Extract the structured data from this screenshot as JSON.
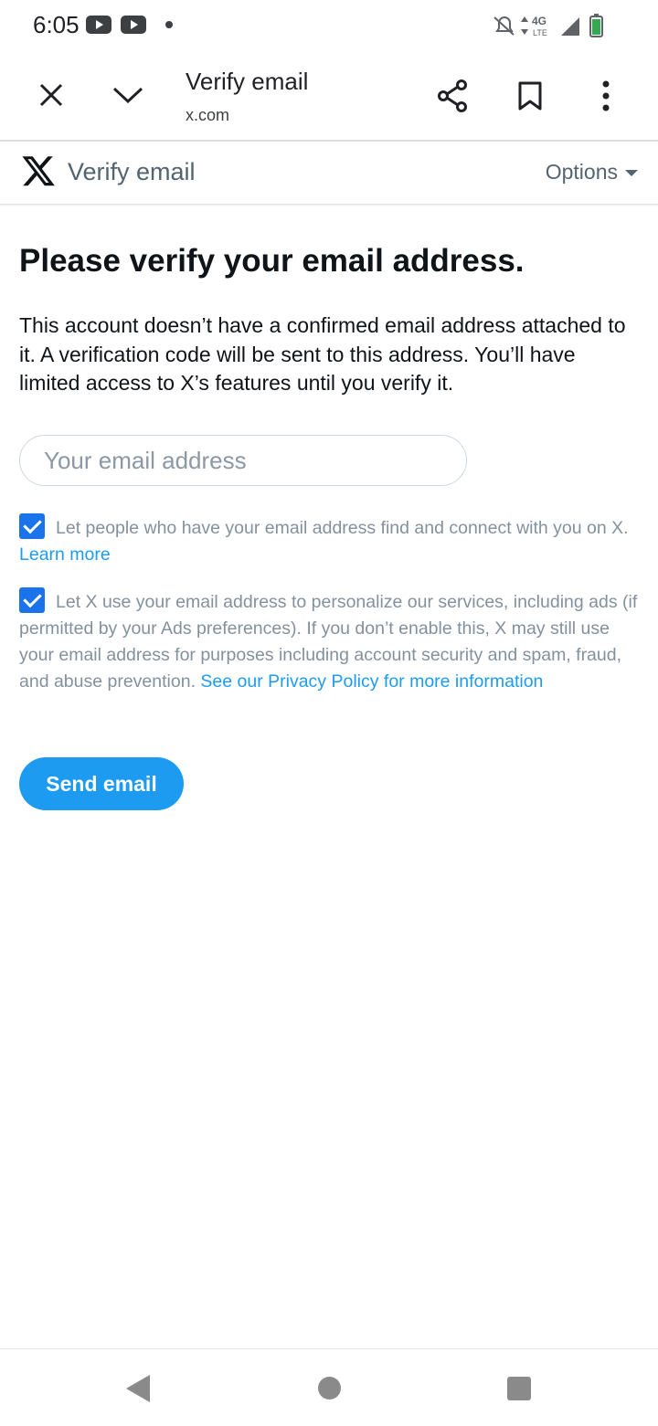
{
  "status_bar": {
    "time": "6:05",
    "network": "4G",
    "network_sub": "LTE"
  },
  "toolbar": {
    "title": "Verify email",
    "url": "x.com"
  },
  "x_header": {
    "title": "Verify email",
    "options_label": "Options"
  },
  "main": {
    "heading": "Please verify your email address.",
    "description": "This account doesn’t have a confirmed email address attached to it. A verification code will be sent to this address. You’ll have limited access to X’s features until you verify it.",
    "email_placeholder": "Your email address",
    "email_value": "",
    "checkbox1": {
      "checked": true,
      "text": "Let people who have your email address find and connect with you on X.",
      "link": "Learn more"
    },
    "checkbox2": {
      "checked": true,
      "text": "Let X use your email address to personalize our services, including ads (if permitted by your Ads preferences). If you don’t enable this, X may still use your email address for purposes including account security and spam, fraud, and abuse prevention.",
      "link": "See our Privacy Policy for more information"
    },
    "send_button": "Send email"
  },
  "colors": {
    "accent": "#1d9bf0",
    "checkbox": "#1a73e8",
    "text_primary": "#0f1419",
    "text_secondary": "#536471"
  },
  "icons": [
    "youtube-icon",
    "youtube-icon",
    "notification-dot-icon",
    "mute-bell-icon",
    "data-arrows-icon",
    "signal-icon",
    "battery-icon",
    "close-icon",
    "chevron-down-icon",
    "share-icon",
    "bookmark-icon",
    "more-vert-icon",
    "x-logo-icon",
    "caret-down-icon",
    "back-icon",
    "home-icon",
    "recents-icon"
  ]
}
